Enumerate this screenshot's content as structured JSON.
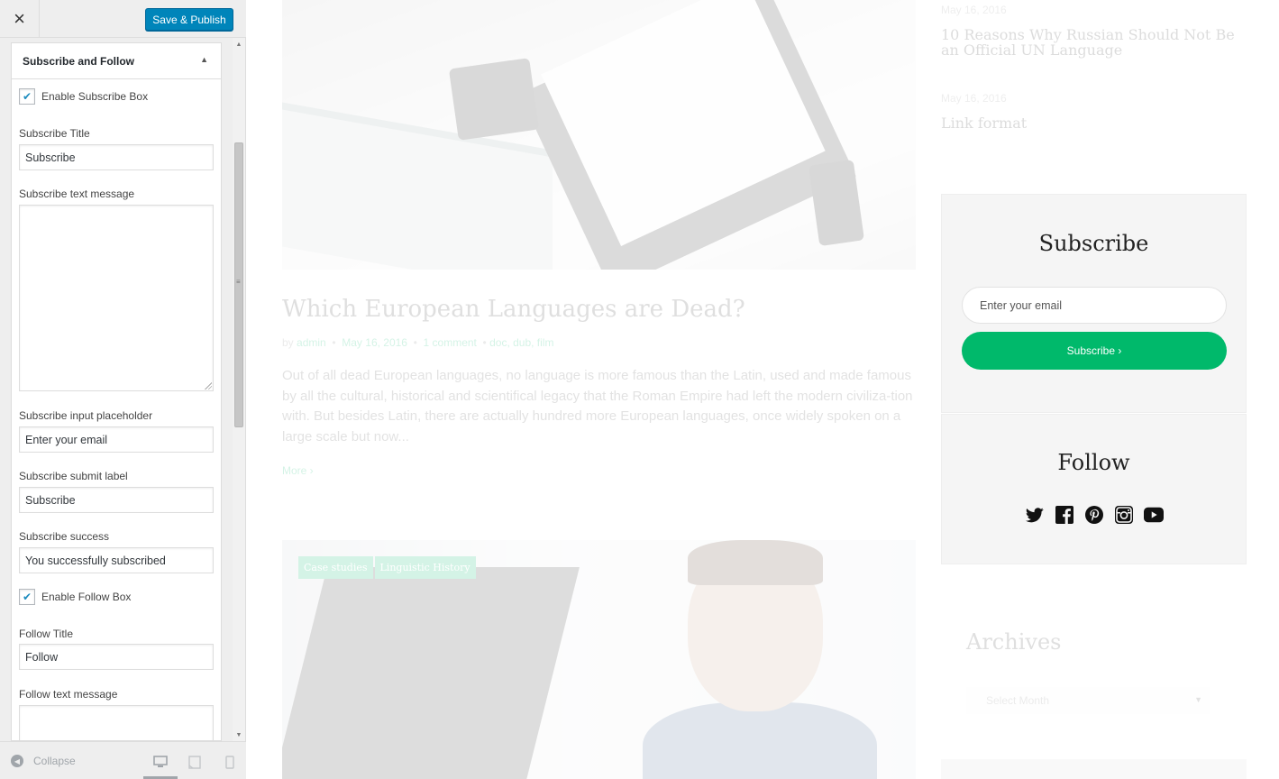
{
  "topbar": {
    "close_icon": "×",
    "publish_label": "Save & Publish"
  },
  "panel": {
    "title": "Subscribe and Follow",
    "enable_subscribe_label": "Enable Subscribe Box",
    "enable_subscribe_checked": true,
    "subscribe_title_label": "Subscribe Title",
    "subscribe_title_value": "Subscribe",
    "subscribe_text_label": "Subscribe text message",
    "subscribe_text_value": "",
    "subscribe_placeholder_label": "Subscribe input placeholder",
    "subscribe_placeholder_value": "Enter your email",
    "subscribe_submit_label": "Subscribe submit label",
    "subscribe_submit_value": "Subscribe",
    "subscribe_success_label": "Subscribe success",
    "subscribe_success_value": "You successfully subscribed",
    "enable_follow_label": "Enable Follow Box",
    "enable_follow_checked": true,
    "follow_title_label": "Follow Title",
    "follow_title_value": "Follow",
    "follow_text_label": "Follow text message"
  },
  "footer": {
    "collapse_label": "Collapse",
    "devices": [
      "desktop-icon",
      "tablet-icon",
      "mobile-icon"
    ],
    "active_device": "desktop"
  },
  "preview": {
    "post": {
      "title": "Which European Languages are Dead?",
      "meta_by": "by",
      "author": "admin",
      "date": "May 16, 2016",
      "comments": "1 comment",
      "tags": "doc, dub, film",
      "excerpt": "Out of all dead European languages, no language is more famous than the Latin, used and made famous by all the cultural, historical and scientifical legacy that the Roman Empire had left the modern civiliza-tion with. But besides Latin, there are actually hundred more European languages, once widely spoken on a large scale but now...",
      "more_label": "More ›"
    },
    "post2_categories": [
      "Case studies",
      "Linguistic History"
    ],
    "recent_posts": [
      {
        "date": "May 16, 2016",
        "title": "10 Reasons Why Russian Should Not Be an Official UN Language"
      },
      {
        "date": "May 16, 2016",
        "title": "Link format"
      }
    ],
    "subscribe_widget": {
      "title": "Subscribe",
      "placeholder": "Enter your email",
      "button_label": "Subscribe ›"
    },
    "follow_widget": {
      "title": "Follow",
      "icons": [
        "twitter-icon",
        "facebook-icon",
        "pinterest-icon",
        "instagram-icon",
        "youtube-icon"
      ]
    },
    "archives": {
      "title": "Archives",
      "select_label": "Select Month"
    }
  },
  "colors": {
    "accent": "#00b96b",
    "publish": "#0085ba",
    "sidebar_bg": "#eeeeee"
  }
}
